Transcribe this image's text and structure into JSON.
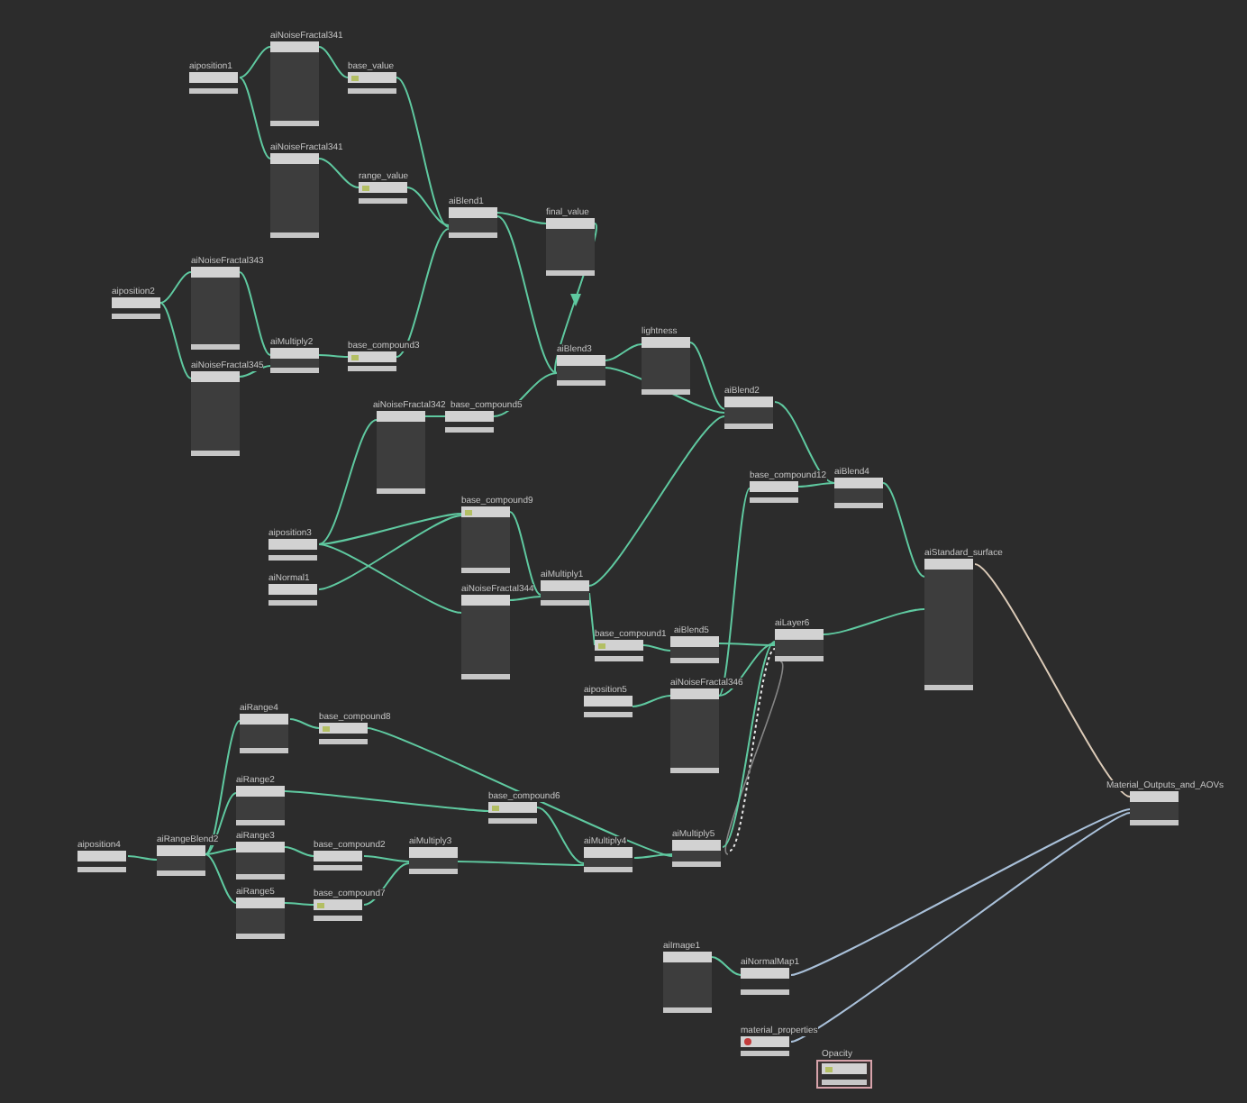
{
  "graph": {
    "nodes": [
      {
        "title": "aiposition1",
        "kind": "value",
        "selected": false
      },
      {
        "title": "aiNoiseFractal341",
        "kind": "shader",
        "selected": false
      },
      {
        "title": "base_value",
        "kind": "value",
        "selected": false
      },
      {
        "title": "aiNoiseFractal341",
        "kind": "shader",
        "selected": false
      },
      {
        "title": "range_value",
        "kind": "value",
        "selected": false
      },
      {
        "title": "aiBlend1",
        "kind": "shader",
        "selected": false
      },
      {
        "title": "final_value",
        "kind": "shader",
        "selected": false
      },
      {
        "title": "aiposition2",
        "kind": "value",
        "selected": false
      },
      {
        "title": "aiNoiseFractal343",
        "kind": "shader",
        "selected": false
      },
      {
        "title": "aiNoiseFractal345",
        "kind": "shader",
        "selected": false
      },
      {
        "title": "aiMultiply2",
        "kind": "shader",
        "selected": false
      },
      {
        "title": "base_compound3",
        "kind": "value",
        "selected": false
      },
      {
        "title": "aiBlend3",
        "kind": "shader",
        "selected": false
      },
      {
        "title": "lightness",
        "kind": "shader",
        "selected": false
      },
      {
        "title": "aiBlend2",
        "kind": "shader",
        "selected": false
      },
      {
        "title": "aiNoiseFractal342",
        "kind": "shader",
        "selected": false
      },
      {
        "title": "base_compound5",
        "kind": "value",
        "selected": false
      },
      {
        "title": "base_compound9",
        "kind": "shader",
        "selected": false
      },
      {
        "title": "aiposition3",
        "kind": "value",
        "selected": false
      },
      {
        "title": "aiNormal1",
        "kind": "value",
        "selected": false
      },
      {
        "title": "aiNoiseFractal344",
        "kind": "shader",
        "selected": false
      },
      {
        "title": "aiMultiply1",
        "kind": "shader",
        "selected": false
      },
      {
        "title": "base_compound12",
        "kind": "value",
        "selected": false
      },
      {
        "title": "aiBlend4",
        "kind": "shader",
        "selected": false
      },
      {
        "title": "aiStandard_surface",
        "kind": "shader",
        "selected": false
      },
      {
        "title": "base_compound1",
        "kind": "value",
        "selected": false
      },
      {
        "title": "aiBlend5",
        "kind": "shader",
        "selected": false
      },
      {
        "title": "aiLayer6",
        "kind": "shader",
        "selected": false
      },
      {
        "title": "aiposition5",
        "kind": "value",
        "selected": false
      },
      {
        "title": "aiNoiseFractal346",
        "kind": "shader",
        "selected": false
      },
      {
        "title": "Material_Outputs_and_AOVs",
        "kind": "shader",
        "selected": false
      },
      {
        "title": "aiRange4",
        "kind": "shader",
        "selected": false
      },
      {
        "title": "base_compound8",
        "kind": "value",
        "selected": false
      },
      {
        "title": "aiRange2",
        "kind": "shader",
        "selected": false
      },
      {
        "title": "base_compound6",
        "kind": "value",
        "selected": false
      },
      {
        "title": "aiRange3",
        "kind": "shader",
        "selected": false
      },
      {
        "title": "aiRange5",
        "kind": "shader",
        "selected": false
      },
      {
        "title": "base_compound2",
        "kind": "value",
        "selected": false
      },
      {
        "title": "base_compound7",
        "kind": "value",
        "selected": false
      },
      {
        "title": "aiMultiply3",
        "kind": "shader",
        "selected": false
      },
      {
        "title": "aiposition4",
        "kind": "value",
        "selected": false
      },
      {
        "title": "aiRangeBlend2",
        "kind": "shader",
        "selected": false
      },
      {
        "title": "aiMultiply4",
        "kind": "shader",
        "selected": false
      },
      {
        "title": "aiMultiply5",
        "kind": "shader",
        "selected": false
      },
      {
        "title": "aiImage1",
        "kind": "shader",
        "selected": false
      },
      {
        "title": "aiNormalMap1",
        "kind": "value",
        "selected": false
      },
      {
        "title": "material_properties",
        "kind": "value",
        "selected": false
      },
      {
        "title": "Opacity",
        "kind": "value",
        "selected": true
      }
    ],
    "connections": [
      {
        "kind": "data"
      },
      {
        "kind": "data"
      },
      {
        "kind": "data"
      },
      {
        "kind": "data"
      },
      {
        "kind": "data"
      },
      {
        "kind": "data"
      },
      {
        "kind": "data"
      },
      {
        "kind": "data"
      },
      {
        "kind": "data"
      },
      {
        "kind": "data"
      },
      {
        "kind": "data"
      },
      {
        "kind": "data"
      },
      {
        "kind": "data"
      },
      {
        "kind": "data"
      },
      {
        "kind": "data"
      },
      {
        "kind": "data"
      },
      {
        "kind": "data"
      },
      {
        "kind": "data"
      },
      {
        "kind": "data"
      },
      {
        "kind": "data"
      },
      {
        "kind": "data"
      },
      {
        "kind": "data"
      },
      {
        "kind": "data"
      },
      {
        "kind": "data"
      },
      {
        "kind": "data"
      },
      {
        "kind": "data"
      },
      {
        "kind": "data"
      },
      {
        "kind": "data"
      },
      {
        "kind": "data"
      },
      {
        "kind": "data"
      },
      {
        "kind": "data"
      },
      {
        "kind": "data"
      },
      {
        "kind": "data"
      },
      {
        "kind": "data"
      },
      {
        "kind": "data"
      },
      {
        "kind": "data"
      },
      {
        "kind": "data"
      },
      {
        "kind": "hidden"
      },
      {
        "kind": "muted"
      },
      {
        "kind": "data"
      },
      {
        "kind": "data"
      },
      {
        "kind": "data"
      },
      {
        "kind": "data"
      },
      {
        "kind": "data"
      },
      {
        "kind": "data"
      },
      {
        "kind": "data"
      },
      {
        "kind": "data"
      },
      {
        "kind": "data"
      },
      {
        "kind": "data"
      },
      {
        "kind": "data"
      },
      {
        "kind": "data"
      },
      {
        "kind": "data"
      },
      {
        "kind": "data"
      },
      {
        "kind": "data"
      },
      {
        "kind": "data"
      },
      {
        "kind": "data"
      },
      {
        "kind": "shader"
      },
      {
        "kind": "aov"
      },
      {
        "kind": "aov"
      }
    ]
  }
}
